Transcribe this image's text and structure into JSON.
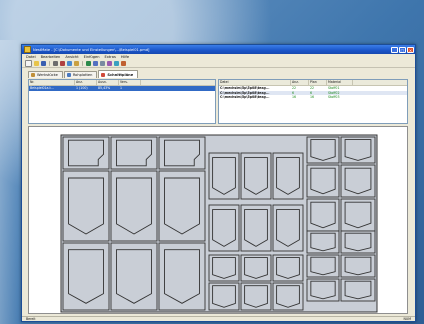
{
  "window": {
    "title": "NestMate - [C:\\Dokumente und Einstellungen\\...\\Beispiel01.pmd]",
    "min_glyph": "_",
    "max_glyph": "□",
    "close_glyph": "×"
  },
  "menu": [
    "Datei",
    "Bearbeiten",
    "Ansicht",
    "Einfügen",
    "Extras",
    "Hilfe"
  ],
  "toolbar_icons": [
    "new-icon",
    "open-icon",
    "save-icon",
    "print-icon",
    "cut-icon",
    "copy-icon",
    "paste-icon",
    "nest-icon",
    "zoom-icon",
    "grid-icon",
    "settings-icon",
    "help-icon",
    "extra-icon"
  ],
  "tabs": [
    {
      "label": "Werkstücke",
      "icon": "part-icon"
    },
    {
      "label": "Rohplatten",
      "icon": "sheet-icon"
    },
    {
      "label": "Schnittpläne",
      "icon": "plan-icon"
    }
  ],
  "left_list": {
    "headers": [
      "Nr.",
      "Anz.",
      "Ausn.",
      "Vers."
    ],
    "rows": [
      {
        "name": "Beispiel01a.t...",
        "qty": "1 (100)",
        "pct": "85,43%",
        "n": "1"
      }
    ]
  },
  "right_list": {
    "headers": [
      "Datei",
      "Anz.",
      "Plan",
      "Material"
    ],
    "rows": [
      {
        "file": "C:\\mechsim\\5p\\5p08\\teag...",
        "a": "22",
        "b": "22",
        "c": "Stoff01"
      },
      {
        "file": "C:\\mechsim\\5p\\5p08\\teag...",
        "a": "6",
        "b": "6",
        "c": "Stoff02"
      },
      {
        "file": "C:\\mechsim\\5p\\5p08\\teag...",
        "a": "16",
        "b": "16",
        "c": "Stoff03"
      }
    ]
  },
  "status": {
    "left": "Bereit",
    "right": "NUM"
  }
}
